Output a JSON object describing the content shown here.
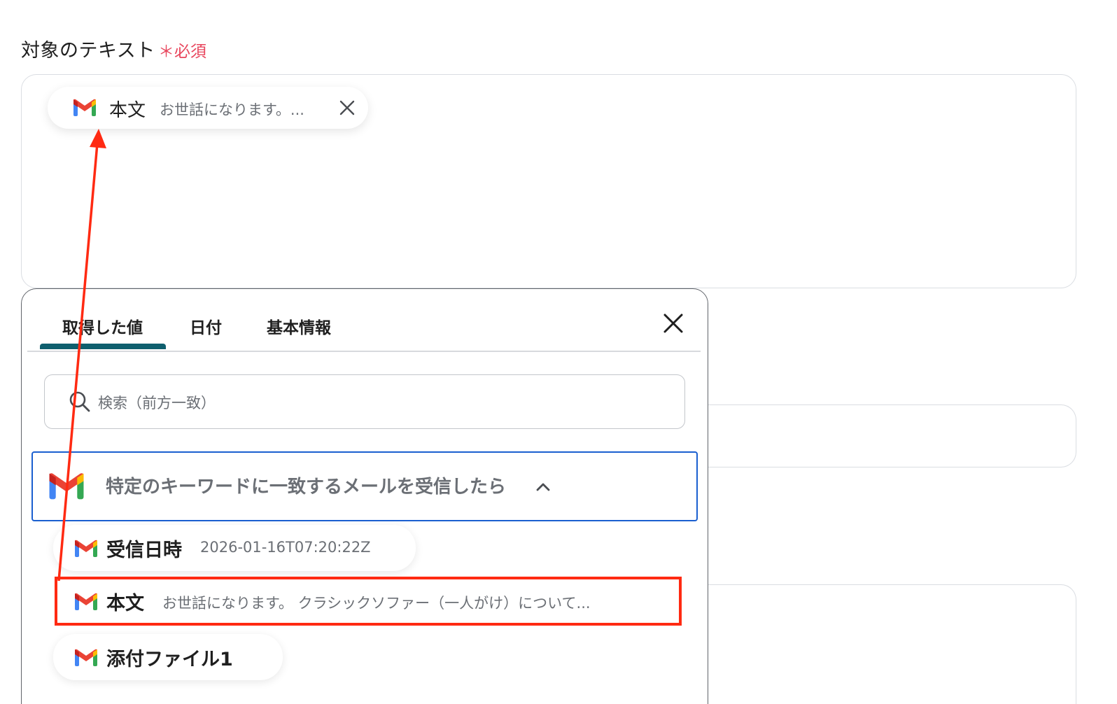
{
  "field": {
    "label": "対象のテキスト",
    "required": "＊必須"
  },
  "selected_chip": {
    "icon": "gmail-icon",
    "label": "本文",
    "value": "お世話になります。..."
  },
  "popup": {
    "tabs": [
      {
        "label": "取得した値",
        "active": true
      },
      {
        "label": "日付",
        "active": false
      },
      {
        "label": "基本情報",
        "active": false
      }
    ],
    "search_placeholder": "検索（前方一致）",
    "group": {
      "icon": "gmail-icon",
      "title": "特定のキーワードに一致するメールを受信したら",
      "expanded": true
    },
    "items": [
      {
        "icon": "gmail-icon",
        "label": "受信日時",
        "value": "2026-01-16T07:20:22Z"
      },
      {
        "icon": "gmail-icon",
        "label": "本文",
        "value": "お世話になります。 クラシックソファー（一人がけ）について..."
      },
      {
        "icon": "gmail-icon",
        "label": "添付ファイル1",
        "value": ""
      }
    ]
  },
  "colors": {
    "active_tab": "#0f5f6e",
    "group_border": "#1a5fd0",
    "highlight": "#ff2a12",
    "required": "#e8465d"
  }
}
